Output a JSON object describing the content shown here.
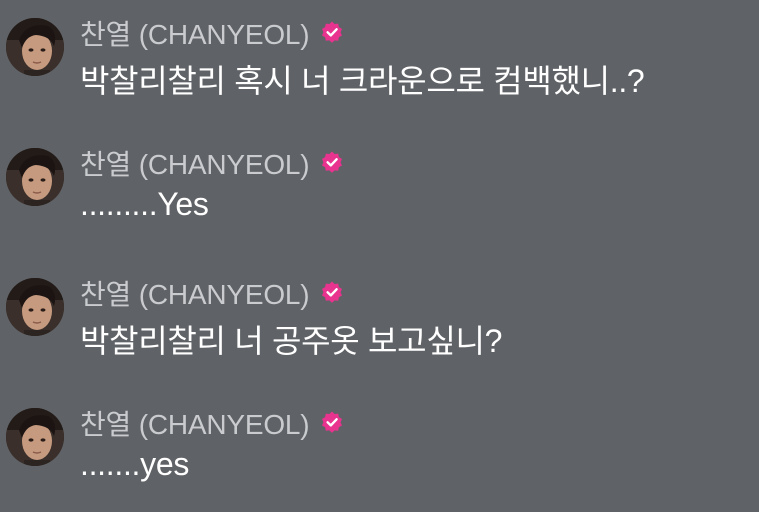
{
  "colors": {
    "background": "#5f6266",
    "username": "#c9cbce",
    "message_text": "#ffffff",
    "verified_badge": "#e8338f"
  },
  "messages": [
    {
      "avatar_icon": "profile-photo",
      "username": "찬열 (CHANYEOL)",
      "badge_icon": "verified-badge-icon",
      "text": "박찰리찰리 혹시 너 크라운으로 컴백했니..?"
    },
    {
      "avatar_icon": "profile-photo",
      "username": "찬열 (CHANYEOL)",
      "badge_icon": "verified-badge-icon",
      "text": ".........Yes"
    },
    {
      "avatar_icon": "profile-photo",
      "username": "찬열 (CHANYEOL)",
      "badge_icon": "verified-badge-icon",
      "text": "박찰리찰리 너 공주옷 보고싶니?"
    },
    {
      "avatar_icon": "profile-photo",
      "username": "찬열 (CHANYEOL)",
      "badge_icon": "verified-badge-icon",
      "text": ".......yes"
    }
  ]
}
